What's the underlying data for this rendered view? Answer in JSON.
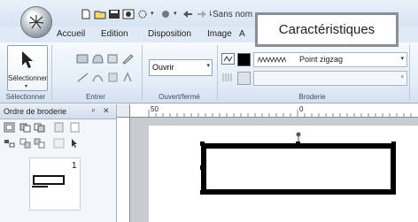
{
  "window": {
    "title": "Sans nom -"
  },
  "ribbon": {
    "tabs": [
      "Accueil",
      "Edition",
      "Disposition",
      "Image",
      "A"
    ],
    "groups": {
      "select": "Sélectionner",
      "enter": "Entrer",
      "open_close": "Ouvert/fermé",
      "embroidery": "Broderie"
    },
    "select_button_label": "Sélectionner",
    "open_close_value": "Ouvrir",
    "stitch_type": "Point zigzag"
  },
  "callout": {
    "text": "Caractéristiques"
  },
  "panel": {
    "title": "Ordre de broderie",
    "pin": "ᵖ",
    "close": "✕",
    "item_number": "1"
  },
  "ruler": {
    "mark_50": "50",
    "mark_0": "0"
  },
  "icons": [
    "app-logo-icon",
    "new-icon",
    "open-icon",
    "save-icon",
    "select-arrow-icon",
    "close-icon",
    "pin-icon"
  ]
}
